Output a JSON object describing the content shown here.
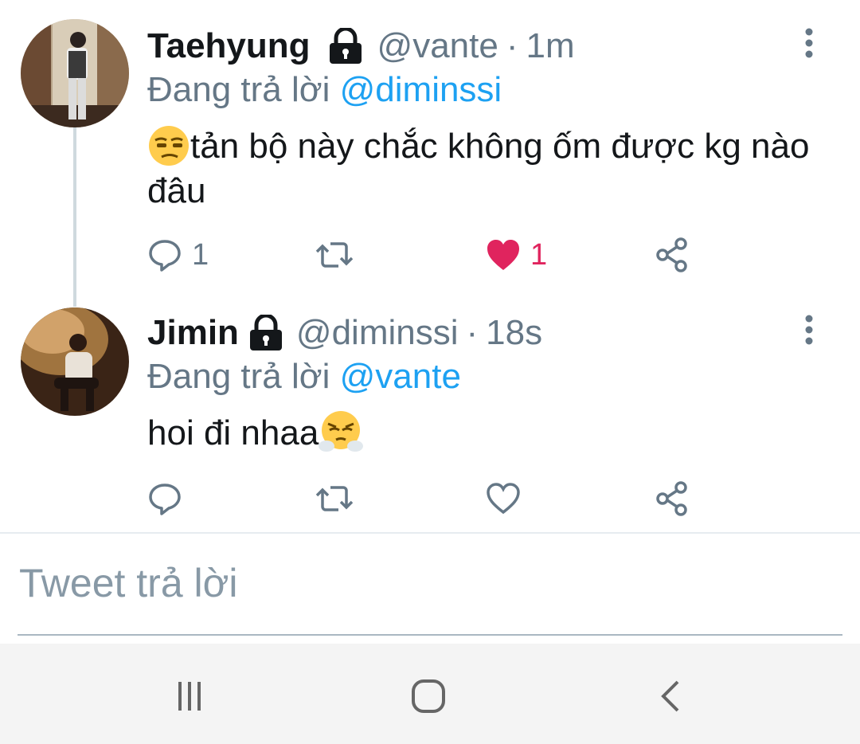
{
  "colors": {
    "accent": "#1da1f2",
    "secondary_text": "#657786",
    "like": "#e0245e",
    "thread_line": "#cfd9de"
  },
  "tweets": [
    {
      "name": "Taehyung",
      "protected_icon": "lock-icon",
      "handle": "@vante",
      "separator": "·",
      "time": "1m",
      "reply_prefix": "Đang trả lời",
      "reply_to": "@diminssi",
      "emoji": "unamused-face",
      "text": "tản bộ này chắc không ốm được kg nào đâu",
      "reply_count": "1",
      "retweet_count": "",
      "like_count": "1",
      "liked": true
    },
    {
      "name": "Jimin",
      "protected_icon": "lock-icon",
      "handle": "@diminssi",
      "separator": "·",
      "time": "18s",
      "reply_prefix": "Đang trả lời",
      "reply_to": "@vante",
      "emoji": "face-with-steam",
      "text": "hoi đi nhaa",
      "reply_count": "",
      "retweet_count": "",
      "like_count": "",
      "liked": false
    }
  ],
  "composer": {
    "placeholder": "Tweet trả lời"
  },
  "navbar": {
    "items": [
      "recent-apps-icon",
      "home-icon",
      "back-icon"
    ]
  }
}
